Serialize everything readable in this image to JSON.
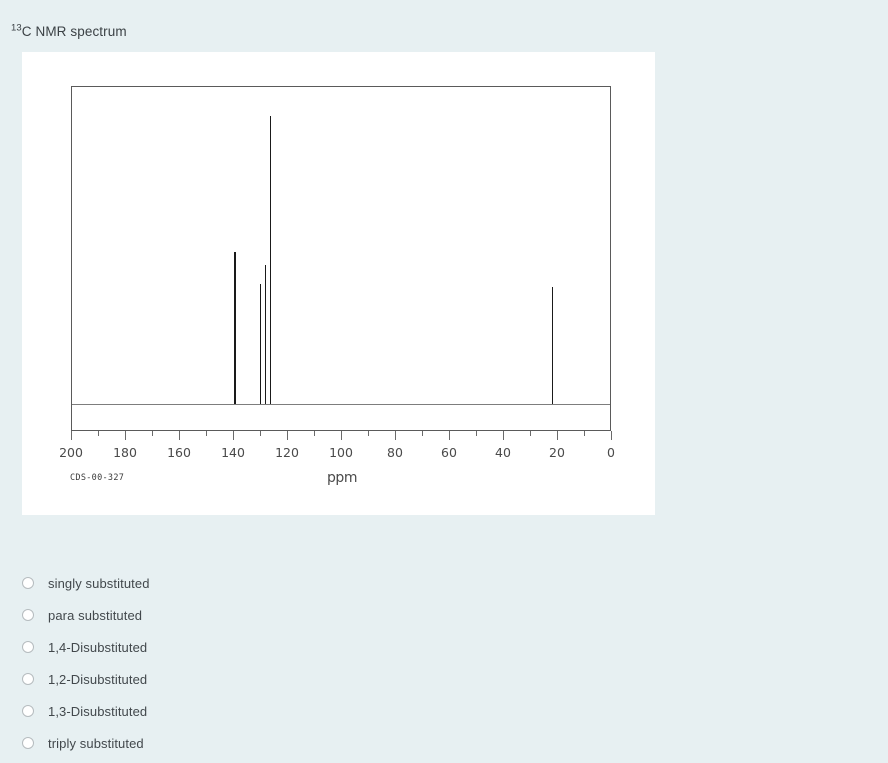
{
  "question": {
    "title_prefix": "13",
    "title_main": "C NMR spectrum"
  },
  "spectrum": {
    "code_label": "CDS-00-327",
    "axis_unit": "ppm",
    "axis_labels": [
      "200",
      "180",
      "160",
      "140",
      "120",
      "100",
      "80",
      "60",
      "40",
      "20",
      "0"
    ]
  },
  "options": [
    {
      "label": "singly substituted"
    },
    {
      "label": "para substituted"
    },
    {
      "label": "1,4-Disubstituted"
    },
    {
      "label": "1,2-Disubstituted"
    },
    {
      "label": "1,3-Disubstituted"
    },
    {
      "label": "triply substituted"
    }
  ],
  "colors": {
    "page_background": "#e7f0f2",
    "panel_background": "#ffffff",
    "trace": "#1a1a1a",
    "frame": "#5a5a5a",
    "text": "#42484c"
  },
  "chart_data": {
    "type": "line",
    "title": "13C NMR spectrum",
    "xlabel": "ppm",
    "ylabel": "",
    "xlim": [
      200,
      0
    ],
    "ylim": [
      0,
      100
    ],
    "grid": false,
    "legend": "none",
    "x_ticks_major": [
      200,
      180,
      160,
      140,
      120,
      100,
      80,
      60,
      40,
      20,
      0
    ],
    "x_ticks_minor": [
      190,
      170,
      150,
      130,
      110,
      90,
      70,
      50,
      30,
      10
    ],
    "annotation": "CDS-00-327",
    "peaks": [
      {
        "ppm": 139.5,
        "intensity": 48,
        "width": 2
      },
      {
        "ppm": 130.5,
        "intensity": 38,
        "width": 1
      },
      {
        "ppm": 128.6,
        "intensity": 44,
        "width": 1
      },
      {
        "ppm": 126.7,
        "intensity": 91,
        "width": 1
      },
      {
        "ppm": 22.2,
        "intensity": 37,
        "width": 1
      }
    ]
  }
}
